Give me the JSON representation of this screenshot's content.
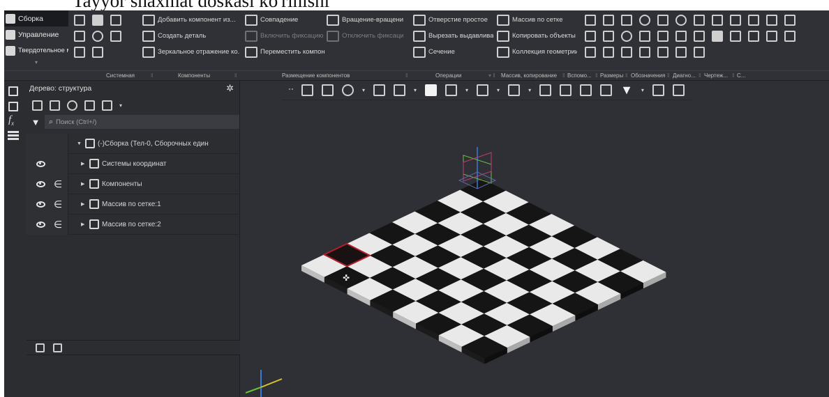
{
  "caption": "Tayyor shaxmat doskasi ko'rinishi",
  "ribbon": {
    "modes": [
      {
        "label": "Сборка",
        "active": true
      },
      {
        "label": "Управление",
        "active": false
      },
      {
        "label": "Твердотельное моделирован...",
        "active": false
      }
    ],
    "col1": {
      "label_a": "Добавить компонент из...",
      "label_b": "Создать деталь",
      "label_c": "Зеркальное отражение ко..."
    },
    "col2": {
      "label_a": "Совпадение",
      "label_b": "Включить фиксацию",
      "label_c": "Переместить компонент"
    },
    "col3": {
      "label_a": "Вращение-вращение",
      "label_b": "Отключить фиксацию"
    },
    "col4": {
      "label_a": "Отверстие простое",
      "label_b": "Вырезать выдавливани...",
      "label_c": "Сечение"
    },
    "col5": {
      "label_a": "Массив по сетке",
      "label_b": "Копировать объекты",
      "label_c": "Коллекция геометрии"
    },
    "groups": [
      "Системная",
      "Компоненты",
      "Размещение компонентов",
      "Операции",
      "Массив, копирование",
      "Вспомо...",
      "Размеры",
      "Обозначения",
      "Диагно...",
      "Чертеж...",
      "С..."
    ]
  },
  "tree_panel": {
    "title": "Дерево: структура",
    "search_placeholder": "Поиск (Ctrl+/)",
    "root": "(-)Сборка (Тел-0, Сборочных един",
    "items": [
      {
        "label": "Системы координат"
      },
      {
        "label": "Компоненты"
      },
      {
        "label": "Массив по сетке:1"
      },
      {
        "label": "Массив по сетке:2"
      }
    ]
  },
  "viewport": {
    "board_rows": 8,
    "board_cols": 8,
    "light_color": "#e9e9e9",
    "dark_color": "#151515",
    "selected_cell": "bottom-left"
  }
}
